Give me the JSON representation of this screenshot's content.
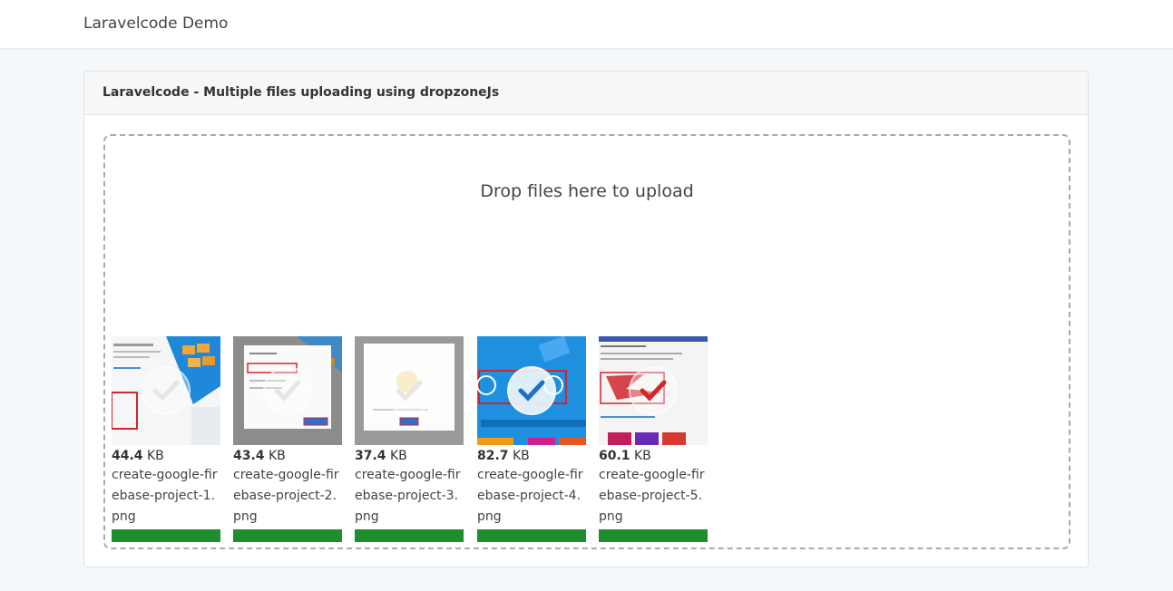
{
  "navbar": {
    "brand": "Laravelcode Demo"
  },
  "card": {
    "title": "Laravelcode - Multiple files uploading using dropzoneJs",
    "dropzone_message": "Drop files here to upload"
  },
  "previews": [
    {
      "size_value": "44.4",
      "size_unit": " KB",
      "filename": "create-google-firebase-project-1.png",
      "progress": 1.0
    },
    {
      "size_value": "43.4",
      "size_unit": " KB",
      "filename": "create-google-firebase-project-2.png",
      "progress": 1.0
    },
    {
      "size_value": "37.4",
      "size_unit": " KB",
      "filename": "create-google-firebase-project-3.png",
      "progress": 1.0
    },
    {
      "size_value": "82.7",
      "size_unit": " KB",
      "filename": "create-google-firebase-project-4.png",
      "progress": 1.0
    },
    {
      "size_value": "60.1",
      "size_unit": " KB",
      "filename": "create-google-firebase-project-5.png",
      "progress": 1.0
    }
  ],
  "colors": {
    "progress_fill": "#1e8e2e",
    "page_bg": "#f5f8fa"
  }
}
